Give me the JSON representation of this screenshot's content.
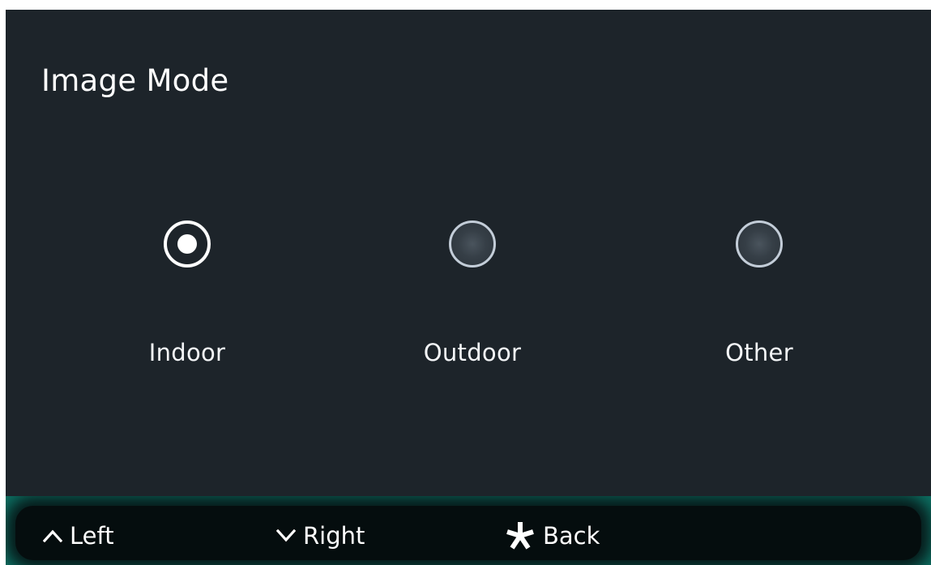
{
  "screen": {
    "title": "Image Mode"
  },
  "options": [
    {
      "label": "Indoor",
      "selected": true
    },
    {
      "label": "Outdoor",
      "selected": false
    },
    {
      "label": "Other",
      "selected": false
    }
  ],
  "footer": {
    "left": {
      "icon": "chevron-up-icon",
      "label": "Left"
    },
    "right": {
      "icon": "chevron-down-icon",
      "label": "Right"
    },
    "back": {
      "icon": "asterisk-icon",
      "label": "Back"
    }
  },
  "colors": {
    "background": "#1d242a",
    "footer_accent": "#0d6f62",
    "text": "#ffffff",
    "radio_ring": "#c3cdd8"
  }
}
